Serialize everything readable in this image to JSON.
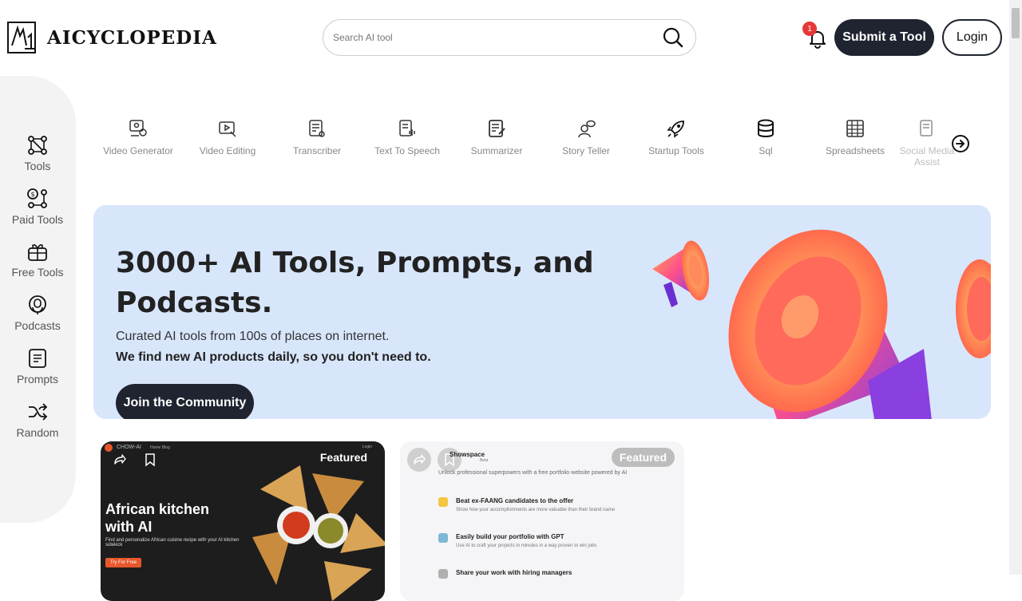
{
  "header": {
    "logo_text": "AICYCLOPEDIA",
    "search_placeholder": "Search AI tool",
    "notification_count": "1",
    "submit_label": "Submit a Tool",
    "login_label": "Login"
  },
  "sidebar": {
    "items": [
      {
        "label": "Tools",
        "icon": "nodes-icon"
      },
      {
        "label": "Paid Tools",
        "icon": "dollar-nodes-icon"
      },
      {
        "label": "Free Tools",
        "icon": "gift-icon"
      },
      {
        "label": "Podcasts",
        "icon": "podcast-icon"
      },
      {
        "label": "Prompts",
        "icon": "document-icon"
      },
      {
        "label": "Random",
        "icon": "shuffle-icon"
      }
    ]
  },
  "categories": [
    {
      "label": "Video Generator",
      "icon": "video-generator-icon"
    },
    {
      "label": "Video Editing",
      "icon": "video-editing-icon"
    },
    {
      "label": "Transcriber",
      "icon": "transcriber-icon"
    },
    {
      "label": "Text To Speech",
      "icon": "text-to-speech-icon"
    },
    {
      "label": "Summarizer",
      "icon": "summarizer-icon"
    },
    {
      "label": "Story Teller",
      "icon": "story-teller-icon"
    },
    {
      "label": "Startup Tools",
      "icon": "rocket-icon"
    },
    {
      "label": "Sql",
      "icon": "database-icon"
    },
    {
      "label": "Spreadsheets",
      "icon": "table-icon"
    },
    {
      "label": "Social Media Assist",
      "icon": "social-icon"
    }
  ],
  "hero": {
    "title": "3000+ AI Tools, Prompts, and Podcasts.",
    "subtitle": "Curated AI tools from 100s of places on internet.",
    "subtitle_bold": "We find new AI products daily, so you don't need to.",
    "cta_label": "Join the Community"
  },
  "cards": [
    {
      "badge": "Featured",
      "brand": "CHOW-AI",
      "nav": "Home   Blog",
      "login": "Login",
      "title": "African kitchen with AI",
      "desc": "Find and personalize African cuisine recipe with your AI kitchen sidekick",
      "cta": "Try For Free"
    },
    {
      "badge": "Featured",
      "brand": "Showspace",
      "beta": "Beta",
      "tagline": "Unlock professional superpowers with a free portfolio website powered by AI",
      "features": [
        {
          "title": "Beat ex-FAANG candidates to the offer",
          "desc": "Show how your accomplishments are more valuable than their brand name"
        },
        {
          "title": "Easily build your portfolio with GPT",
          "desc": "Use AI to craft your projects in minutes in a way proven to win jobs"
        },
        {
          "title": "Share your work with hiring managers",
          "desc": ""
        }
      ]
    }
  ],
  "colors": {
    "primary_dark": "#1f2430",
    "hero_bg": "#d8e6fb",
    "badge_red": "#e53935"
  }
}
